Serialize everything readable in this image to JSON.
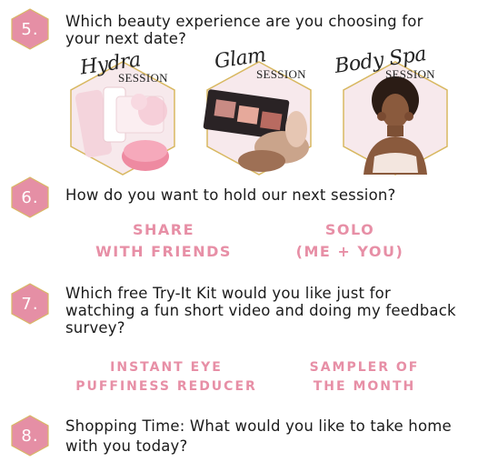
{
  "questions": [
    {
      "number": "5.",
      "text_line1": "Which beauty experience are you choosing for",
      "text_line2": "your next date?"
    },
    {
      "number": "6.",
      "text_line1": "How do you want to hold our next session?"
    },
    {
      "number": "7.",
      "text_line1": "Which free Try-It Kit would you like just for",
      "text_line2": "watching a fun short video and doing my feedback",
      "text_line3": "survey?"
    },
    {
      "number": "8.",
      "text_line1": "Shopping Time: What would you like to take home",
      "text_line2": "with you today?"
    }
  ],
  "sessions": [
    {
      "script": "Hydra",
      "label": "SESSION"
    },
    {
      "script": "Glam",
      "label": "SESSION"
    },
    {
      "script": "Body Spa",
      "label": "SESSION"
    }
  ],
  "hold_options": [
    {
      "line1": "SHARE",
      "line2": "WITH FRIENDS"
    },
    {
      "line1": "SOLO",
      "line2": "(ME + YOU)"
    }
  ],
  "kit_options": [
    {
      "line1": "INSTANT EYE",
      "line2": "PUFFINESS REDUCER"
    },
    {
      "line1": "SAMPLER OF",
      "line2": "THE MONTH"
    }
  ],
  "colors": {
    "badge": "#e58fa5",
    "accent_text": "#e78fa6",
    "hex_gold": "#d4b45a"
  }
}
